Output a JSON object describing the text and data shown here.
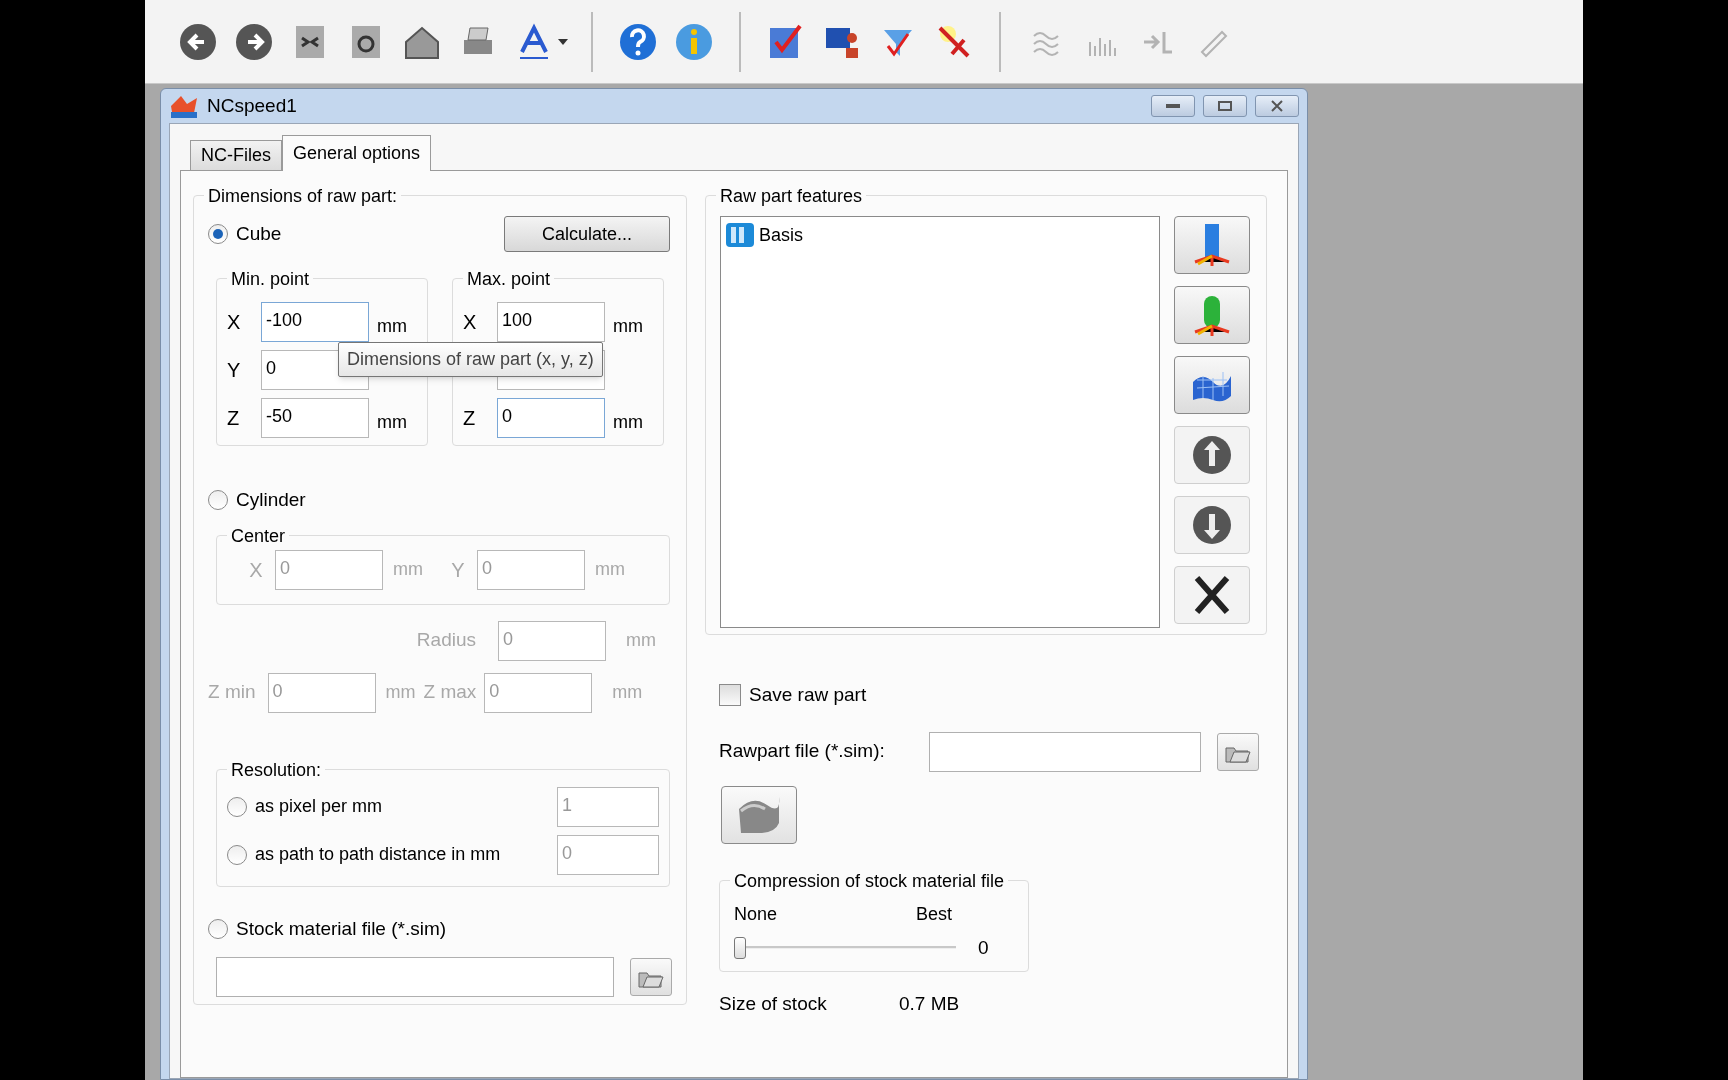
{
  "window": {
    "title": "NCspeed1"
  },
  "tabs": [
    {
      "label": "NC-Files",
      "selected": false
    },
    {
      "label": "General options",
      "selected": true
    }
  ],
  "dimensions": {
    "title": "Dimensions of raw part:"
  },
  "cube": {
    "label": "Cube",
    "selected": true,
    "button": "Calculate...",
    "min_point": {
      "title": "Min. point",
      "rows": [
        {
          "kind": "field",
          "axis": "X",
          "value": "-100",
          "unit": "mm",
          "focused": true
        },
        {
          "kind": "field",
          "axis": "Y",
          "value": "0",
          "focused": false
        },
        {
          "kind": "field",
          "axis": "Z",
          "value": "-50",
          "unit": "mm",
          "focused": false
        }
      ]
    },
    "max_point": {
      "title": "Max. point",
      "rows": [
        {
          "kind": "field",
          "axis": "X",
          "value": "100",
          "unit": "mm",
          "focused": false
        },
        {
          "kind": "covered"
        },
        {
          "kind": "field",
          "axis": "Z",
          "value": "0",
          "unit": "mm",
          "focused": true
        }
      ]
    }
  },
  "tooltip": "Dimensions of raw part (x, y, z)",
  "cylinder": {
    "label": "Cylinder",
    "selected": false,
    "disabled": true,
    "center_title": "Center",
    "center": [
      {
        "axis": "X",
        "value": "0",
        "unit": "mm"
      },
      {
        "axis": "Y",
        "value": "0",
        "unit": "mm"
      }
    ],
    "radius": {
      "label": "Radius",
      "value": "0",
      "unit": "mm"
    },
    "z_range": [
      {
        "axis": "Z min",
        "value": "0",
        "unit": "mm"
      },
      {
        "axis": "Z max",
        "value": "0",
        "unit": "mm"
      }
    ]
  },
  "resolution": {
    "title": "Resolution:",
    "options": [
      {
        "label": "as pixel per mm",
        "selected": false,
        "value": "1"
      },
      {
        "label": "as path to path distance in mm",
        "selected": false,
        "value": "0"
      }
    ]
  },
  "stock_file": {
    "label": "Stock material file (*.sim)",
    "selected": false
  },
  "features": {
    "title": "Raw part features",
    "items": [
      {
        "label": "Basis"
      }
    ]
  },
  "save_raw_part": {
    "label": "Save raw part",
    "checked": false
  },
  "rawpart_file": {
    "label": "Rawpart file (*.sim):"
  },
  "compression": {
    "title": "Compression of stock material file",
    "min_label": "None",
    "max_label": "Best",
    "level": 0,
    "reading": "0"
  },
  "stock_size": {
    "label": "Size of stock",
    "value": "0.7 MB"
  }
}
